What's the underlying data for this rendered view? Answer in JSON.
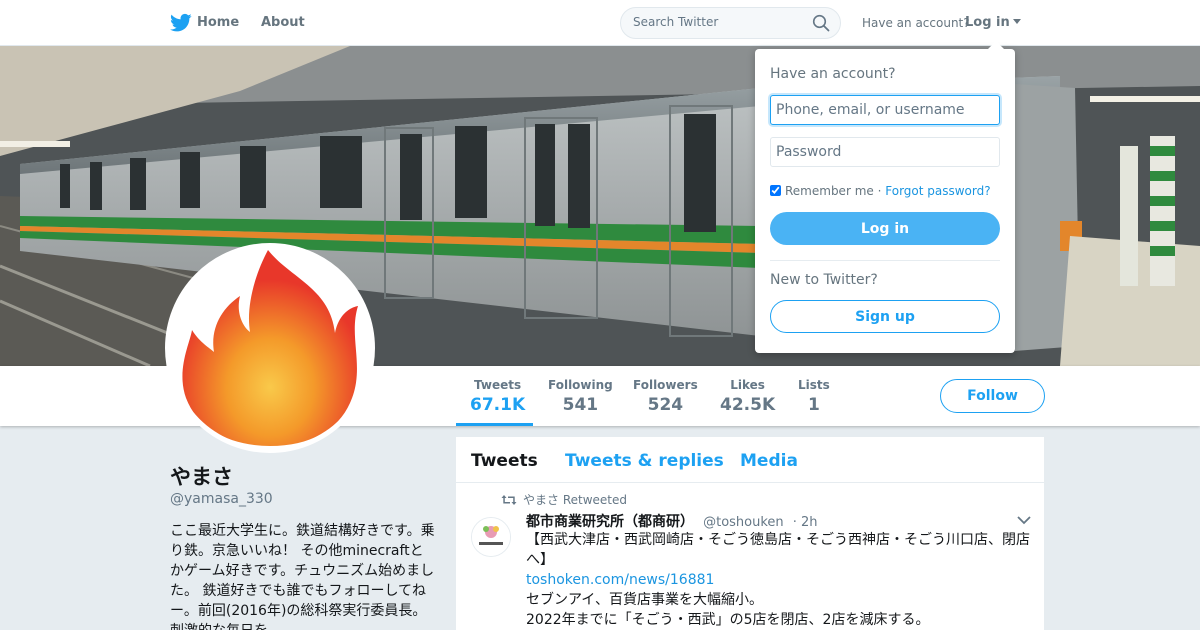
{
  "nav": {
    "home_label": "Home",
    "about_label": "About",
    "search_placeholder": "Search Twitter",
    "have_account": "Have an account?",
    "login_label": "Log in"
  },
  "profile": {
    "name": "やまさ",
    "handle": "@yamasa_330",
    "bio": "ここ最近大学生に。鉄道結構好きです。乗り鉄。京急いいね！ その他minecraftとかゲーム好きです。チュウニズム始めました。 鉄道好きでも誰でもフォローしてねー。前回(2016年)の総科祭実行委員長。刺激的な毎日を"
  },
  "stats": [
    {
      "label": "Tweets",
      "value": "67.1K"
    },
    {
      "label": "Following",
      "value": "541"
    },
    {
      "label": "Followers",
      "value": "524"
    },
    {
      "label": "Likes",
      "value": "42.5K"
    },
    {
      "label": "Lists",
      "value": "1"
    }
  ],
  "follow_label": "Follow",
  "timeline": {
    "tabs": [
      "Tweets",
      "Tweets & replies",
      "Media"
    ],
    "tweet": {
      "retweeted_by": "やまさ Retweeted",
      "author_name": "都市商業研究所（都商研）",
      "author_handle": "@toshouken",
      "time": "· 2h",
      "line1": "【西武大津店・西武岡崎店・そごう徳島店・そごう西神店・そごう川口店、閉店へ】",
      "link": "toshoken.com/news/16881",
      "line2": "セブンアイ、百貨店事業を大幅縮小。",
      "line3": "2022年までに「そごう・西武」の5店を閉店、2店を減床する。"
    }
  },
  "login_dropdown": {
    "heading": "Have an account?",
    "username_placeholder": "Phone, email, or username",
    "password_placeholder": "Password",
    "remember_label": "Remember me",
    "separator": "·",
    "forgot_label": "Forgot password?",
    "login_button": "Log in",
    "new_to_twitter": "New to Twitter?",
    "signup_button": "Sign up"
  },
  "colors": {
    "accent": "#1da1f2",
    "link": "#1b95e0",
    "login_button": "#4ab3f4",
    "background": "#e6ecf0"
  }
}
